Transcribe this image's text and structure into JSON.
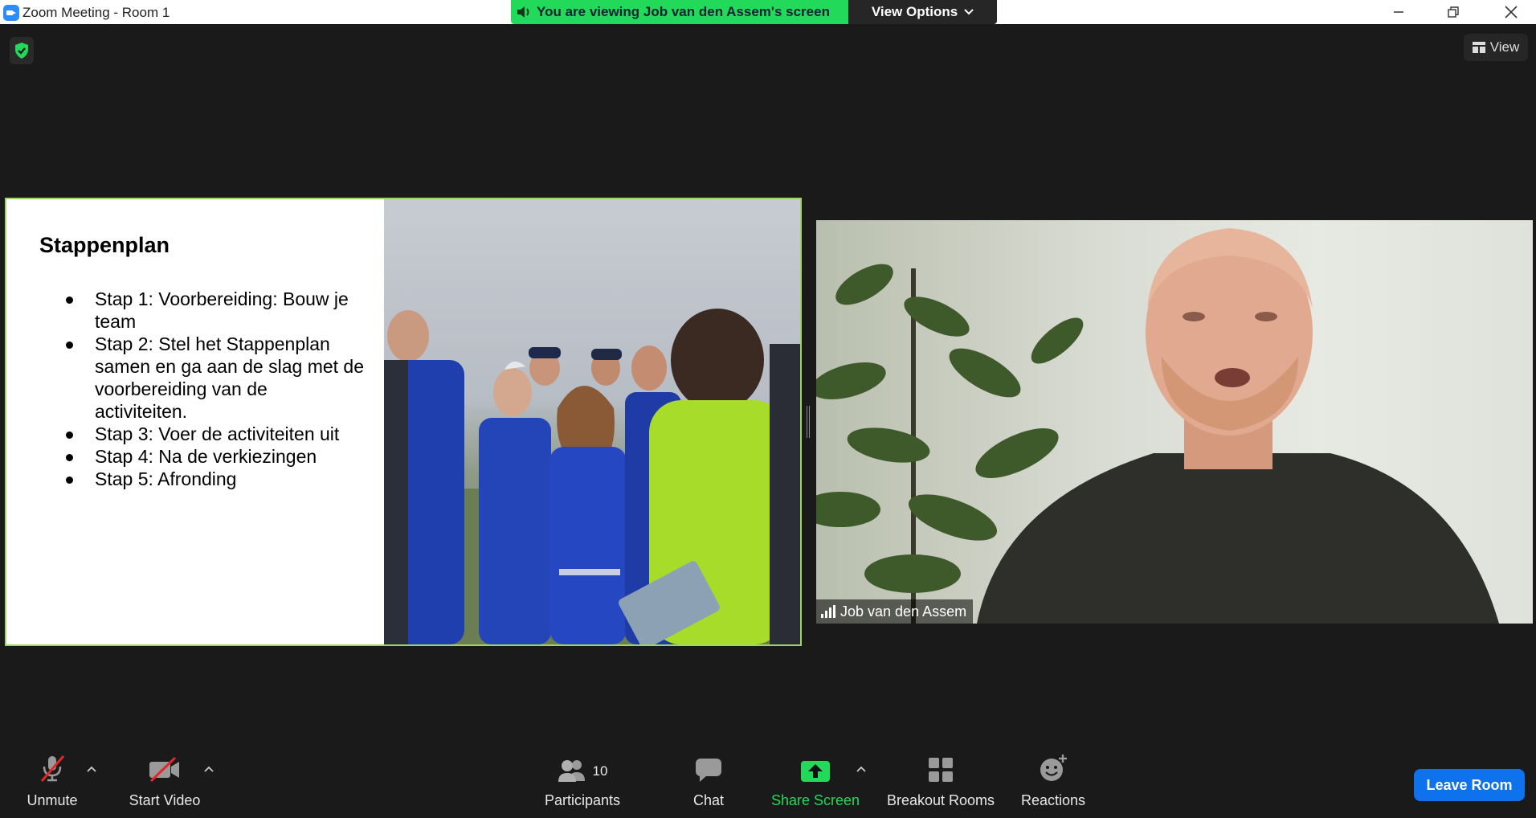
{
  "window": {
    "title": "Zoom Meeting - Room 1"
  },
  "banner": {
    "text": "You are viewing Job van den Assem's screen",
    "view_options": "View Options",
    "color": "#23d959"
  },
  "top_right": {
    "view_label": "View"
  },
  "slide": {
    "title": "Stappenplan",
    "bullets": [
      "Stap 1: Voorbereiding: Bouw je team",
      "Stap 2: Stel het Stappenplan samen en ga aan de slag met de voorbereiding van de activiteiten.",
      "Stap 3: Voer de activiteiten uit",
      "Stap 4: Na de verkiezingen",
      "Stap 5: Afronding"
    ]
  },
  "video": {
    "participant_name": "Job van den Assem"
  },
  "toolbar": {
    "unmute": "Unmute",
    "start_video": "Start Video",
    "participants": "Participants",
    "participants_count": "10",
    "chat": "Chat",
    "share_screen": "Share Screen",
    "breakout_rooms": "Breakout Rooms",
    "reactions": "Reactions",
    "leave_room": "Leave Room",
    "share_color": "#23d959",
    "leave_color": "#0e72ed"
  }
}
